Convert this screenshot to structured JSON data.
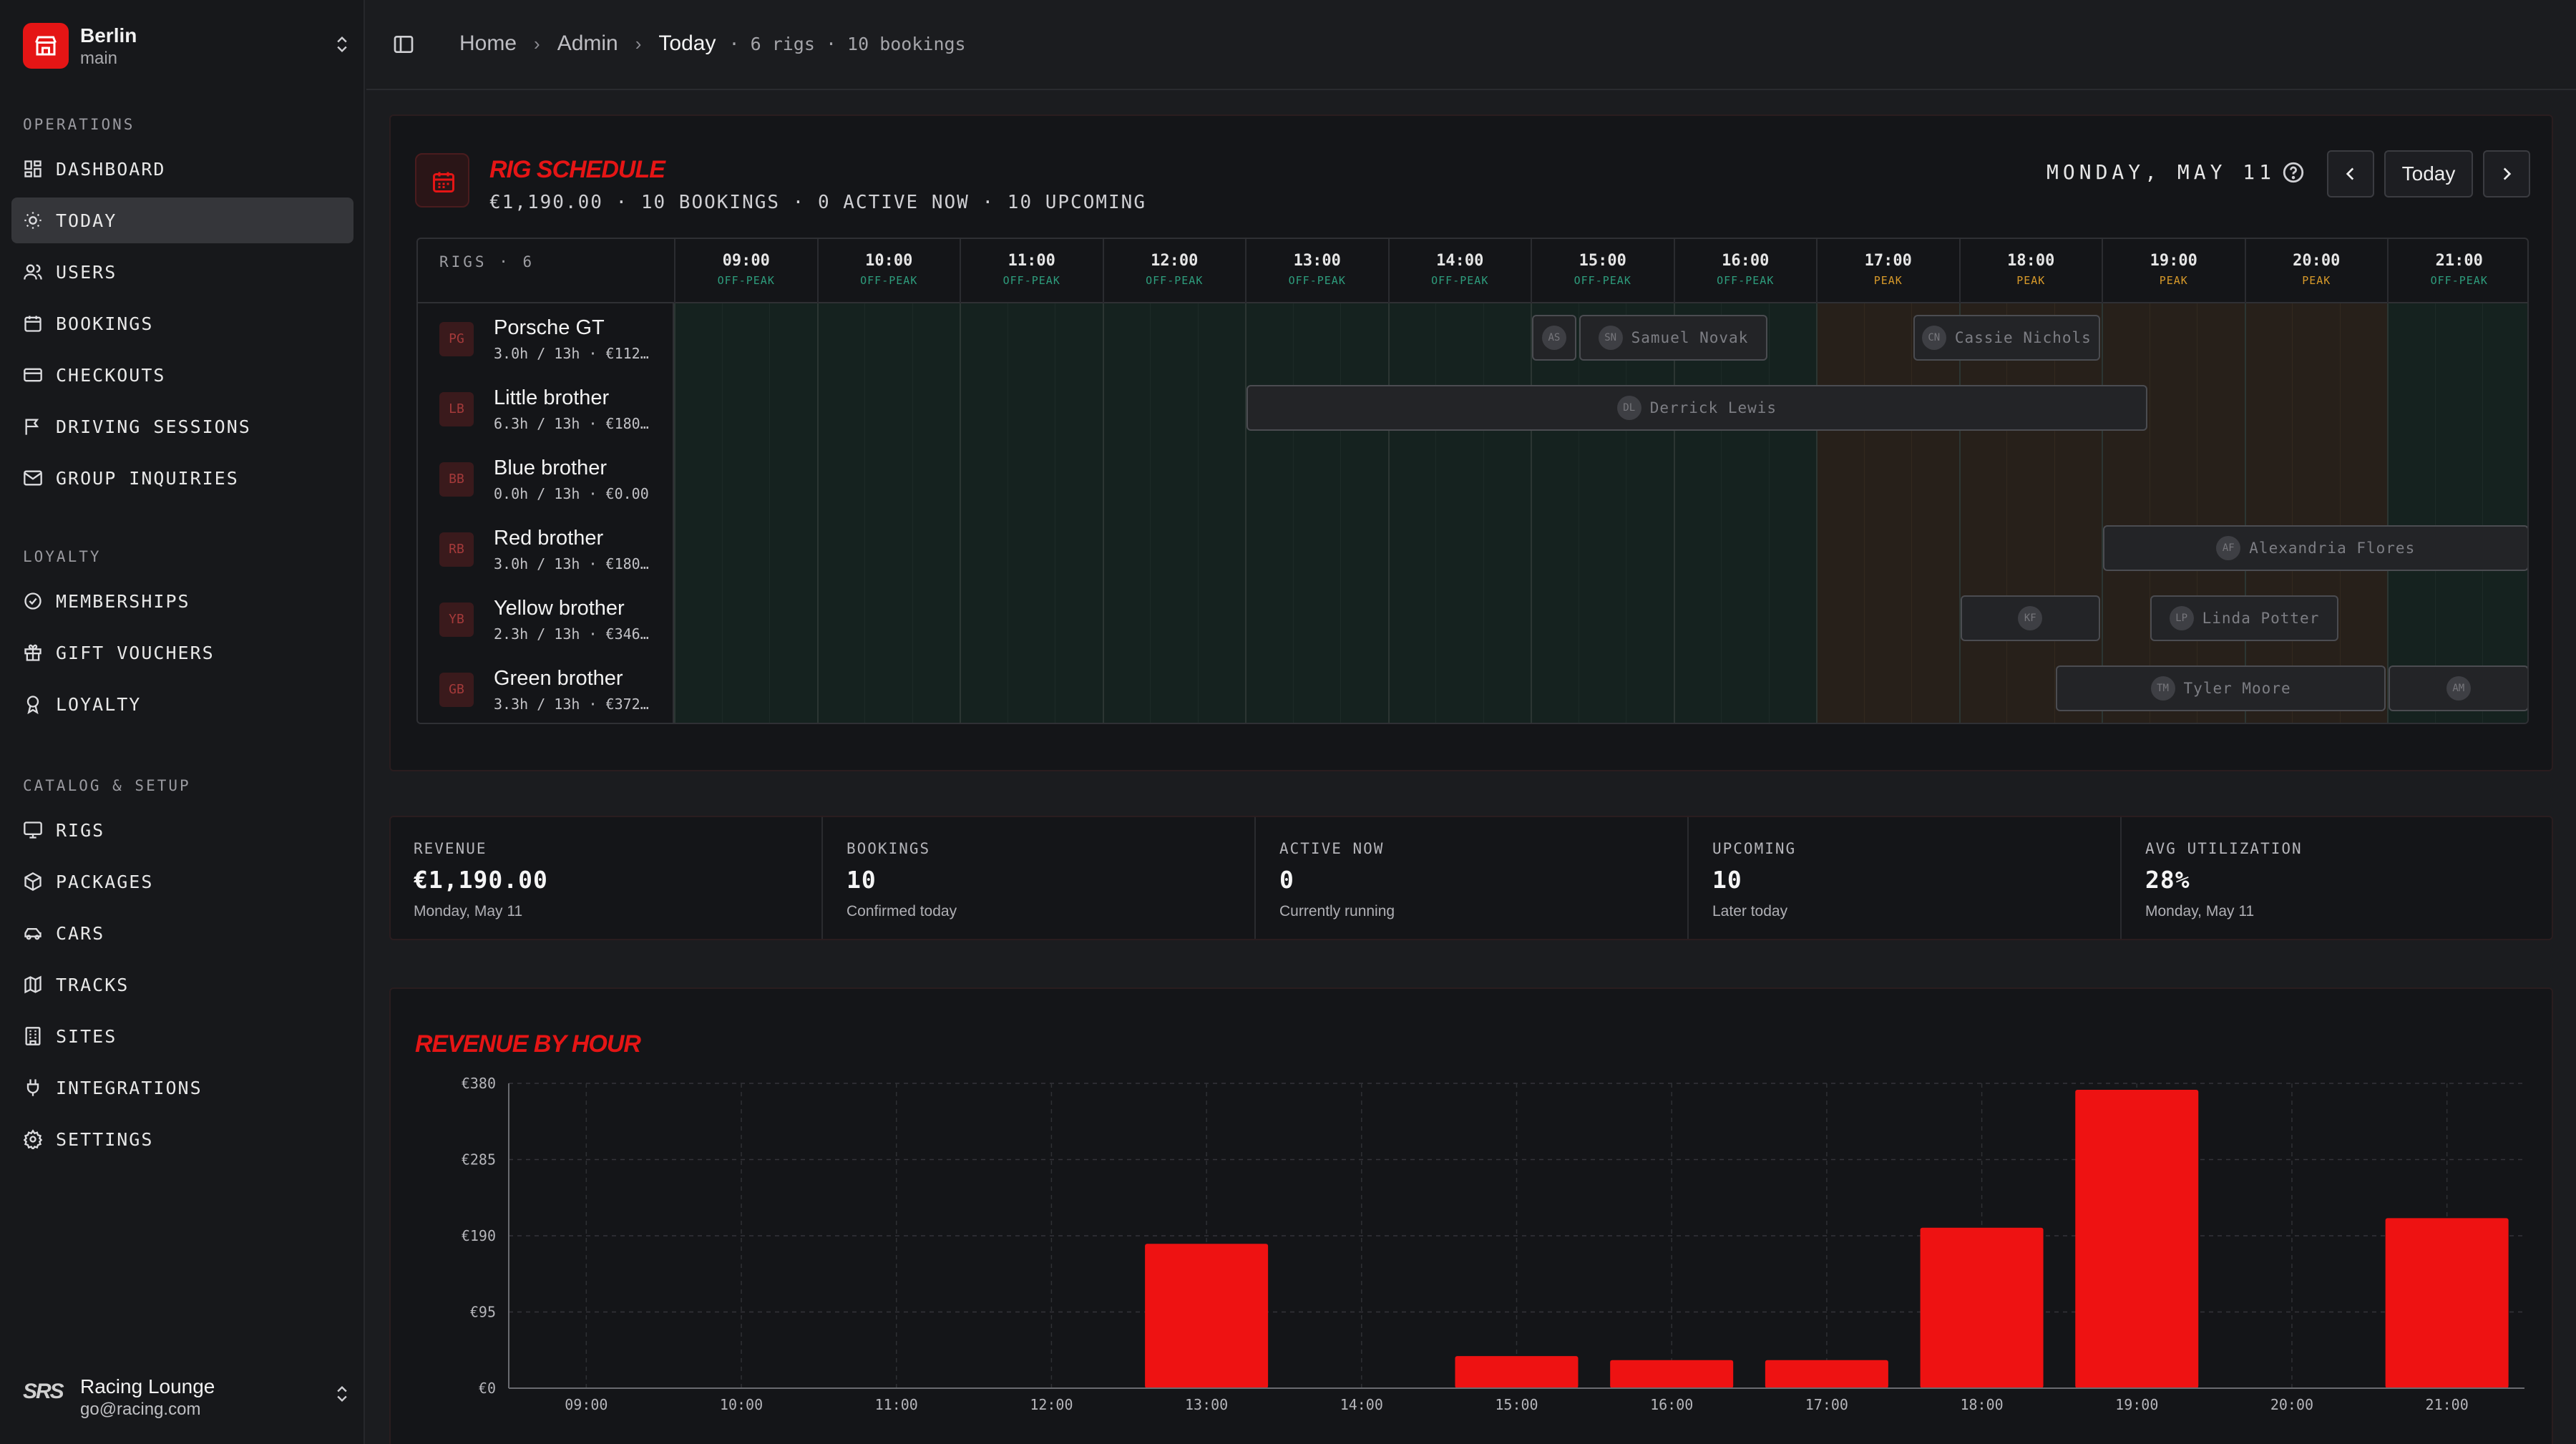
{
  "workspace": {
    "site": "Berlin",
    "branch": "main"
  },
  "sidebar": {
    "sections": [
      {
        "label": "OPERATIONS",
        "items": [
          "DASHBOARD",
          "TODAY",
          "USERS",
          "BOOKINGS",
          "CHECKOUTS",
          "DRIVING SESSIONS",
          "GROUP INQUIRIES"
        ]
      },
      {
        "label": "LOYALTY",
        "items": [
          "MEMBERSHIPS",
          "GIFT VOUCHERS",
          "LOYALTY"
        ]
      },
      {
        "label": "CATALOG & SETUP",
        "items": [
          "RIGS",
          "PACKAGES",
          "CARS",
          "TRACKS",
          "SITES",
          "INTEGRATIONS",
          "SETTINGS"
        ]
      }
    ],
    "active_item": "TODAY",
    "account": {
      "logo_text": "SRS",
      "name": "Racing Lounge",
      "email": "go@racing.com"
    }
  },
  "breadcrumb": {
    "items": [
      "Home",
      "Admin",
      "Today"
    ],
    "meta": "· 6 rigs · 10 bookings"
  },
  "schedule": {
    "title": "RIG SCHEDULE",
    "subtitle": "€1,190.00 · 10 BOOKINGS · 0 ACTIVE NOW · 10 UPCOMING",
    "date_label": "MONDAY, MAY 11",
    "today_button": "Today",
    "rigs_label": "RIGS · 6",
    "hours": [
      {
        "time": "09:00",
        "tier": "OFF-PEAK"
      },
      {
        "time": "10:00",
        "tier": "OFF-PEAK"
      },
      {
        "time": "11:00",
        "tier": "OFF-PEAK"
      },
      {
        "time": "12:00",
        "tier": "OFF-PEAK"
      },
      {
        "time": "13:00",
        "tier": "OFF-PEAK"
      },
      {
        "time": "14:00",
        "tier": "OFF-PEAK"
      },
      {
        "time": "15:00",
        "tier": "OFF-PEAK"
      },
      {
        "time": "16:00",
        "tier": "OFF-PEAK"
      },
      {
        "time": "17:00",
        "tier": "PEAK"
      },
      {
        "time": "18:00",
        "tier": "PEAK"
      },
      {
        "time": "19:00",
        "tier": "PEAK"
      },
      {
        "time": "20:00",
        "tier": "PEAK"
      },
      {
        "time": "21:00",
        "tier": "OFF-PEAK"
      }
    ],
    "rigs": [
      {
        "initials": "PG",
        "name": "Porsche GT",
        "stats": "3.0h / 13h · €112…",
        "bookings": [
          {
            "start": 15.0,
            "end": 15.33,
            "initials": "AS",
            "name": ""
          },
          {
            "start": 15.33,
            "end": 16.67,
            "initials": "SN",
            "name": "Samuel Novak"
          },
          {
            "start": 17.67,
            "end": 19.0,
            "initials": "CN",
            "name": "Cassie Nichols"
          }
        ]
      },
      {
        "initials": "LB",
        "name": "Little brother",
        "stats": "6.3h / 13h · €180…",
        "bookings": [
          {
            "start": 13.0,
            "end": 19.33,
            "initials": "DL",
            "name": "Derrick Lewis"
          }
        ]
      },
      {
        "initials": "BB",
        "name": "Blue brother",
        "stats": "0.0h / 13h · €0.00",
        "bookings": []
      },
      {
        "initials": "RB",
        "name": "Red brother",
        "stats": "3.0h / 13h · €180…",
        "bookings": [
          {
            "start": 19.0,
            "end": 22.0,
            "initials": "AF",
            "name": "Alexandria Flores"
          }
        ]
      },
      {
        "initials": "YB",
        "name": "Yellow brother",
        "stats": "2.3h / 13h · €346…",
        "bookings": [
          {
            "start": 18.0,
            "end": 19.0,
            "initials": "KF",
            "name": ""
          },
          {
            "start": 19.33,
            "end": 20.67,
            "initials": "LP",
            "name": "Linda Potter"
          }
        ]
      },
      {
        "initials": "GB",
        "name": "Green brother",
        "stats": "3.3h / 13h · €372…",
        "bookings": [
          {
            "start": 18.67,
            "end": 21.0,
            "initials": "TM",
            "name": "Tyler Moore"
          },
          {
            "start": 21.0,
            "end": 22.0,
            "initials": "AM",
            "name": ""
          }
        ]
      }
    ]
  },
  "stats": [
    {
      "label": "REVENUE",
      "value": "€1,190.00",
      "note": "Monday, May 11"
    },
    {
      "label": "BOOKINGS",
      "value": "10",
      "note": "Confirmed today"
    },
    {
      "label": "ACTIVE NOW",
      "value": "0",
      "note": "Currently running"
    },
    {
      "label": "UPCOMING",
      "value": "10",
      "note": "Later today"
    },
    {
      "label": "AVG UTILIZATION",
      "value": "28%",
      "note": "Monday, May 11"
    }
  ],
  "revenue": {
    "title": "REVENUE BY HOUR",
    "chart_data": {
      "type": "bar",
      "title": "REVENUE BY HOUR",
      "categories": [
        "09:00",
        "10:00",
        "11:00",
        "12:00",
        "13:00",
        "14:00",
        "15:00",
        "16:00",
        "17:00",
        "18:00",
        "19:00",
        "20:00",
        "21:00"
      ],
      "values": [
        0,
        0,
        0,
        0,
        180,
        0,
        40,
        35,
        35,
        200,
        372,
        0,
        212
      ],
      "y_ticks": [
        "€0",
        "€95",
        "€190",
        "€285",
        "€380"
      ],
      "ylim": [
        0,
        380
      ],
      "grid": true,
      "bar_color": "#ee1212"
    }
  },
  "colors": {
    "accent": "#e51515",
    "off_peak": "#2e9d7d",
    "peak": "#d89a2a"
  }
}
